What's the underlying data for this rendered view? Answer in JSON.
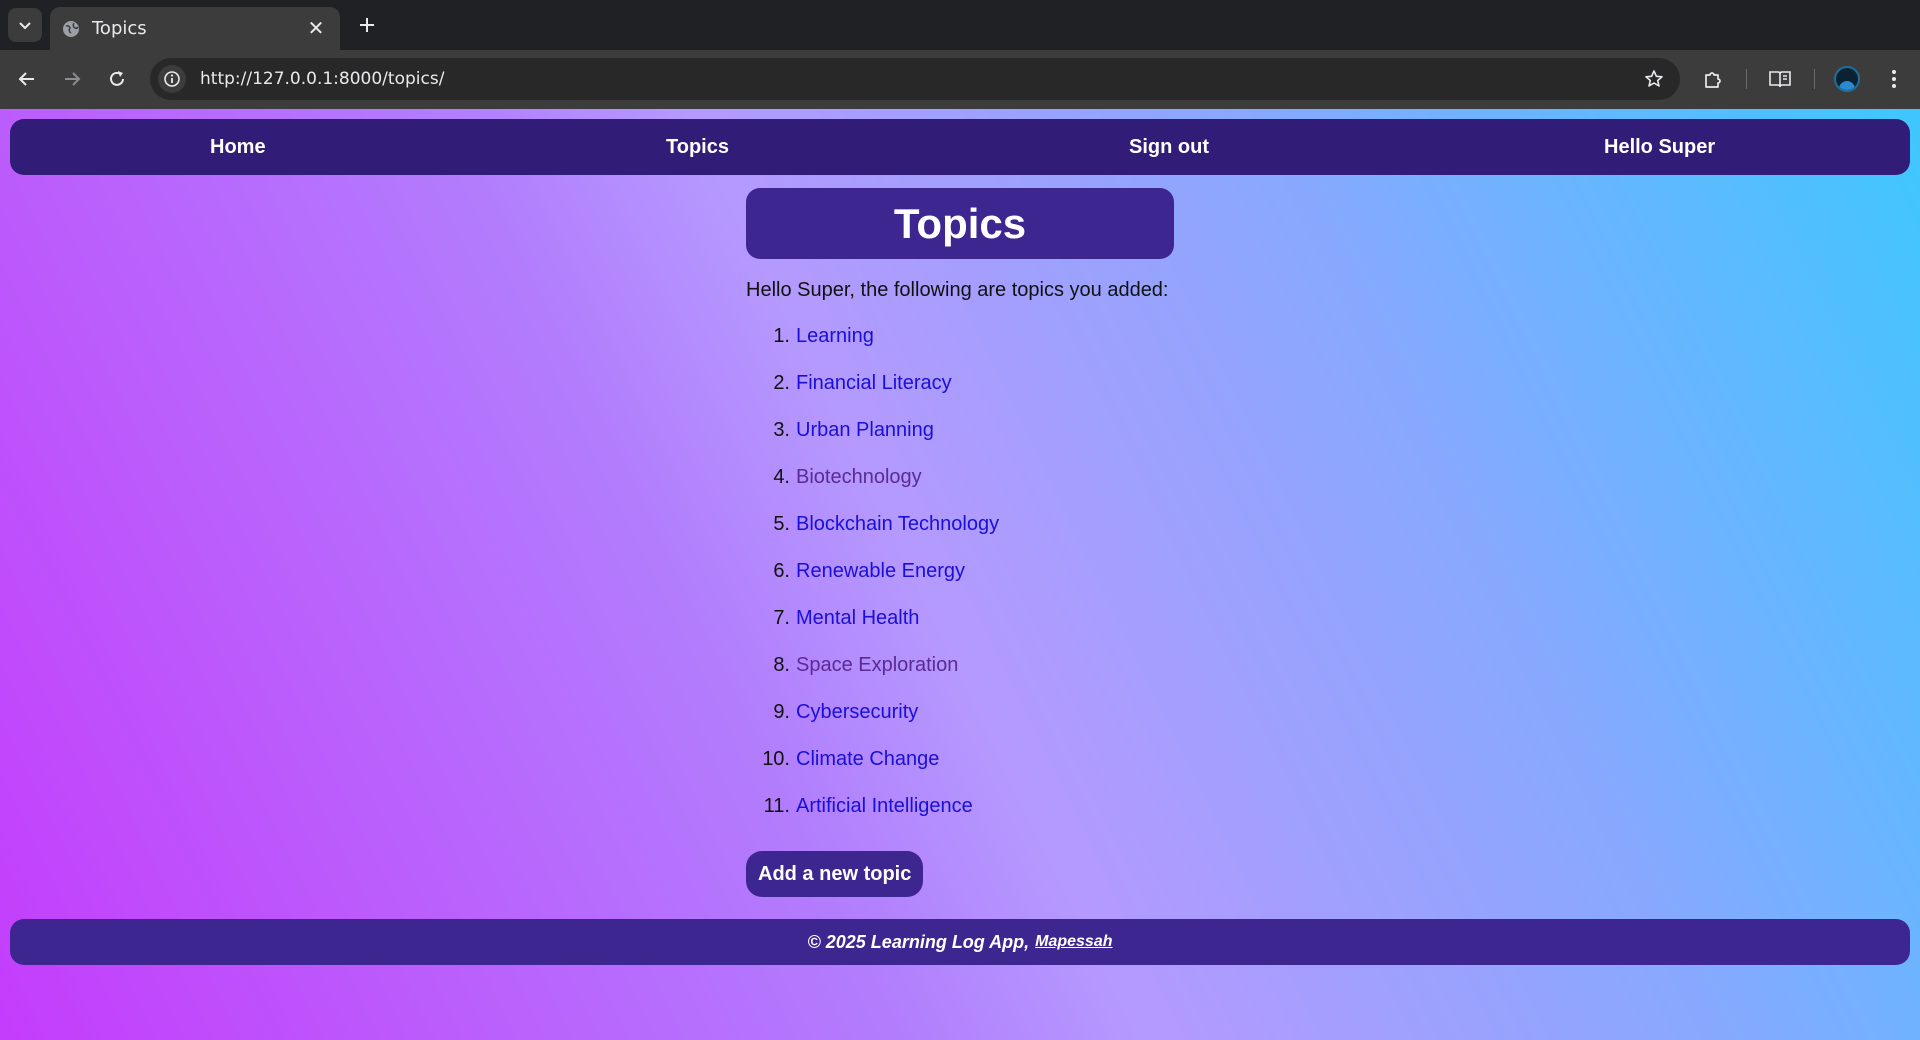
{
  "browser": {
    "tab_title": "Topics",
    "close_glyph": "✕",
    "url": "http://127.0.0.1:8000/topics/"
  },
  "navbar": {
    "home": "Home",
    "topics": "Topics",
    "sign_out": "Sign out",
    "greeting": "Hello Super"
  },
  "main": {
    "title": "Topics",
    "intro": "Hello Super, the following are topics you added:",
    "topics": [
      {
        "number": "1.",
        "label": "Learning",
        "visited": false
      },
      {
        "number": "2.",
        "label": "Financial Literacy",
        "visited": false
      },
      {
        "number": "3.",
        "label": "Urban Planning",
        "visited": false
      },
      {
        "number": "4.",
        "label": "Biotechnology",
        "visited": true
      },
      {
        "number": "5.",
        "label": "Blockchain Technology",
        "visited": false
      },
      {
        "number": "6.",
        "label": "Renewable Energy",
        "visited": false
      },
      {
        "number": "7.",
        "label": "Mental Health",
        "visited": false
      },
      {
        "number": "8.",
        "label": "Space Exploration",
        "visited": true
      },
      {
        "number": "9.",
        "label": "Cybersecurity",
        "visited": false
      },
      {
        "number": "10.",
        "label": "Climate Change",
        "visited": false
      },
      {
        "number": "11.",
        "label": "Artificial Intelligence",
        "visited": false
      }
    ],
    "add_button": "Add a new topic"
  },
  "footer": {
    "text": "© 2025 Learning Log App,",
    "link": "Mapessah"
  },
  "colors": {
    "nav_bg": "#311c78",
    "panel_bg": "#3e2690",
    "link": "#1a0fd6",
    "visited_link": "#5a2a95",
    "gradient_start": "#c43cfc",
    "gradient_end": "#3ec7fd"
  },
  "icons": {
    "tab_search": "chevron-down-icon",
    "tab_favicon": "globe-icon",
    "new_tab": "plus-icon",
    "back": "arrow-left-icon",
    "forward": "arrow-right-icon",
    "reload": "reload-icon",
    "site_info": "info-icon",
    "bookmark": "star-icon",
    "extensions": "puzzle-icon",
    "reading_mode": "book-icon",
    "menu": "kebab-menu-icon"
  }
}
